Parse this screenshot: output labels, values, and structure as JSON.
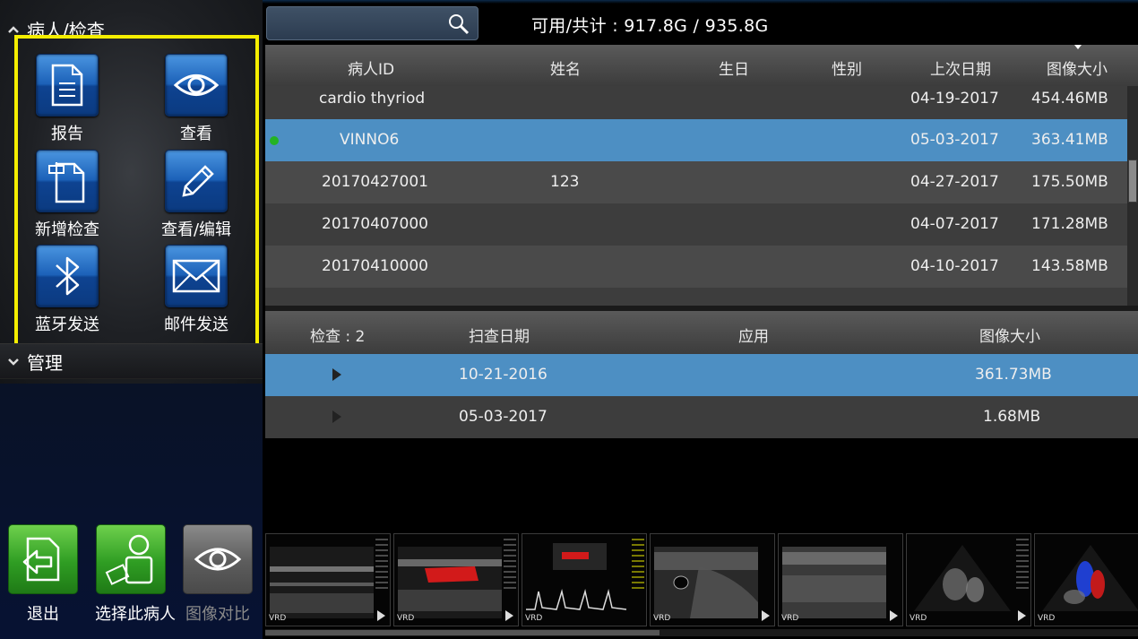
{
  "sidebar": {
    "patient_section": {
      "label": "病人/检查",
      "chevron": "chevron-up-icon"
    },
    "manage_section": {
      "label": "管理",
      "chevron": "chevron-down-icon"
    },
    "actions": [
      {
        "label": "报告",
        "icon": "report-document-icon"
      },
      {
        "label": "查看",
        "icon": "eye-icon"
      },
      {
        "label": "新增检查",
        "icon": "new-exam-icon"
      },
      {
        "label": "查看/编辑",
        "icon": "pencil-icon"
      },
      {
        "label": "蓝牙发送",
        "icon": "bluetooth-icon"
      },
      {
        "label": "邮件发送",
        "icon": "mail-icon"
      }
    ],
    "bottom_buttons": [
      {
        "label": "退出",
        "icon": "exit-icon"
      },
      {
        "label": "选择此病人",
        "icon": "select-patient-icon"
      },
      {
        "label": "图像对比",
        "icon": "eye-icon",
        "disabled": true
      }
    ],
    "highlight_color": "#f5ee00"
  },
  "topbar": {
    "storage": "可用/共计 : 917.8G / 935.8G",
    "search_icon": "search-icon"
  },
  "patient_table": {
    "headers": [
      "病人ID",
      "姓名",
      "生日",
      "性别",
      "上次日期",
      "图像大小"
    ],
    "rows": [
      {
        "id": "cardio thyriod",
        "name": "",
        "birthday": "",
        "sex": "",
        "last_date": "04-19-2017",
        "size": "454.46MB",
        "selected": false
      },
      {
        "id": "VINNO6",
        "name": "",
        "birthday": "",
        "sex": "",
        "last_date": "05-03-2017",
        "size": "363.41MB",
        "selected": true
      },
      {
        "id": "20170427001",
        "name": "123",
        "birthday": "",
        "sex": "",
        "last_date": "04-27-2017",
        "size": "175.50MB",
        "selected": false
      },
      {
        "id": "20170407000",
        "name": "",
        "birthday": "",
        "sex": "",
        "last_date": "04-07-2017",
        "size": "171.28MB",
        "selected": false
      },
      {
        "id": "20170410000",
        "name": "",
        "birthday": "",
        "sex": "",
        "last_date": "04-10-2017",
        "size": "143.58MB",
        "selected": false
      }
    ]
  },
  "exam_table": {
    "headers": [
      "检查 : 2",
      "扫查日期",
      "应用",
      "图像大小"
    ],
    "rows": [
      {
        "scan_date": "10-21-2016",
        "application": "",
        "size": "361.73MB",
        "selected": true
      },
      {
        "scan_date": "05-03-2017",
        "application": "",
        "size": "1.68MB",
        "selected": false
      }
    ]
  },
  "thumbnails": [
    {
      "tag": "VRD",
      "kind": "carotid-bmode"
    },
    {
      "tag": "VRD",
      "kind": "carotid-color"
    },
    {
      "tag": "VRD",
      "kind": "doppler"
    },
    {
      "tag": "VRD",
      "kind": "thyroid-bmode"
    },
    {
      "tag": "VRD",
      "kind": "thyroid-bmode-2"
    },
    {
      "tag": "VRD",
      "kind": "cardiac"
    },
    {
      "tag": "VRD",
      "kind": "cardiac-color"
    }
  ],
  "colors": {
    "selected_row": "#4d8fc3",
    "online_dot": "#24b324",
    "tile_blue": "#1c61b8",
    "tile_green": "#2f9d23"
  }
}
